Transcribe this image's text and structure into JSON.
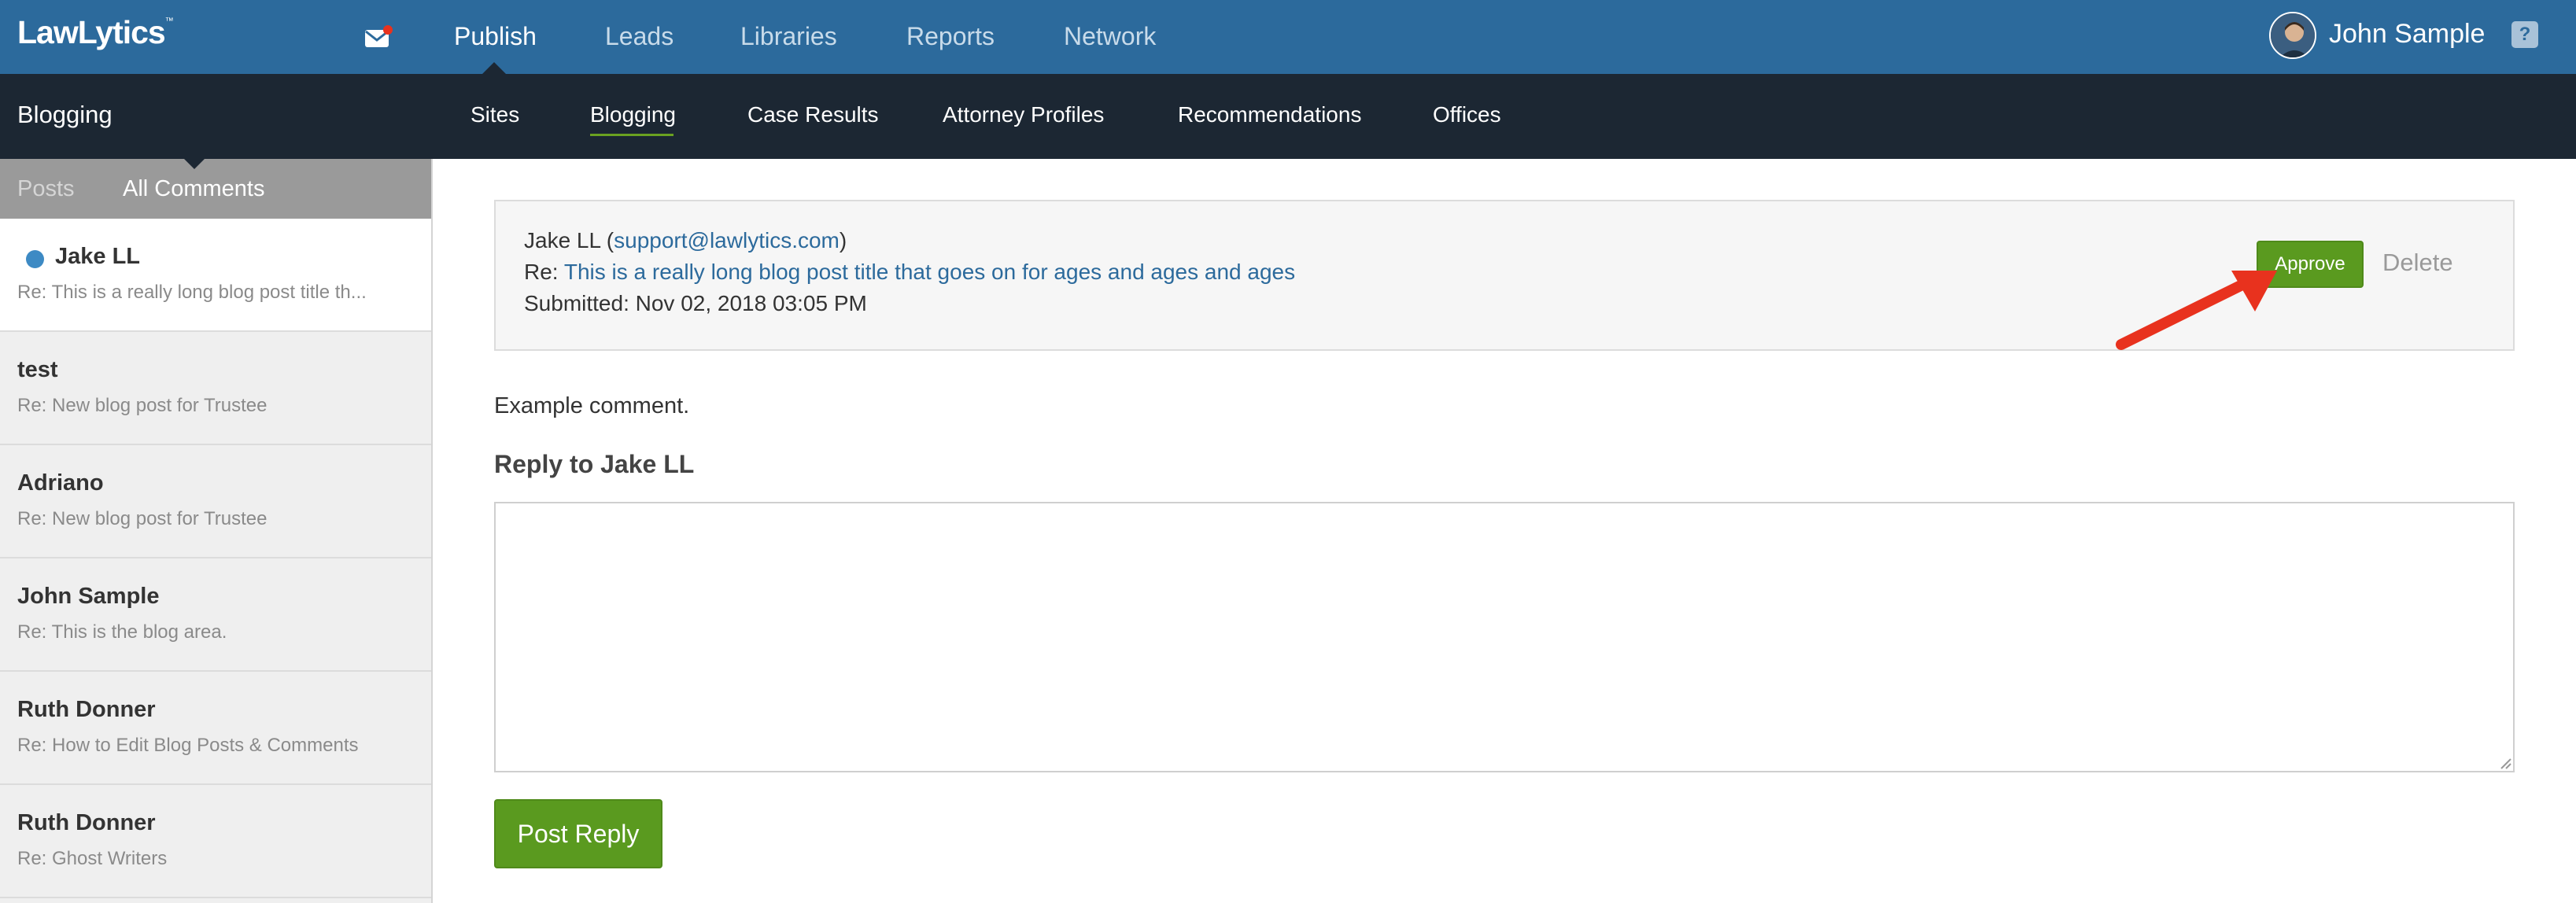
{
  "app": {
    "logo": "LawLytics",
    "logo_mark": "™",
    "user_name": "John Sample",
    "help_label": "?"
  },
  "top_nav": {
    "items": [
      "Publish",
      "Leads",
      "Libraries",
      "Reports",
      "Network"
    ],
    "active": "Publish"
  },
  "sub_nav": {
    "section_title": "Blogging",
    "items": [
      "Sites",
      "Blogging",
      "Case Results",
      "Attorney Profiles",
      "Recommendations",
      "Offices"
    ],
    "active": "Blogging"
  },
  "sidebar": {
    "tabs": [
      "Posts",
      "All Comments"
    ],
    "active_tab": "All Comments",
    "items": [
      {
        "name": "Jake LL",
        "subject": "Re: This is a really long blog post title th...",
        "unread": true,
        "selected": true
      },
      {
        "name": "test",
        "subject": "Re: New blog post for Trustee",
        "unread": false,
        "selected": false
      },
      {
        "name": "Adriano",
        "subject": "Re: New blog post for Trustee",
        "unread": false,
        "selected": false
      },
      {
        "name": "John Sample",
        "subject": "Re: This is the blog area.",
        "unread": false,
        "selected": false
      },
      {
        "name": "Ruth Donner",
        "subject": "Re: How to Edit Blog Posts & Comments",
        "unread": false,
        "selected": false
      },
      {
        "name": "Ruth Donner",
        "subject": "Re: Ghost Writers",
        "unread": false,
        "selected": false
      }
    ]
  },
  "comment": {
    "author": "Jake LL",
    "email": "support@lawlytics.com",
    "re_label": "Re:",
    "post_title": "This is a really long blog post title that goes on for ages and ages and ages",
    "submitted_label": "Submitted:",
    "submitted": "Nov 02, 2018 03:05 PM",
    "body": "Example comment.",
    "approve_label": "Approve",
    "delete_label": "Delete"
  },
  "reply": {
    "label": "Reply to Jake LL",
    "value": "",
    "submit_label": "Post Reply"
  },
  "colors": {
    "topbar": "#2c6a9c",
    "subbar": "#1c2733",
    "accent_green": "#5a9a1f",
    "link": "#2c6a9c",
    "unread_dot": "#3d8ac4",
    "annotation_arrow": "#e8321e"
  },
  "icons": [
    "mail-icon",
    "notification-dot-icon",
    "avatar-photo",
    "help-icon",
    "annotation-arrow-icon",
    "resize-grip-icon"
  ]
}
